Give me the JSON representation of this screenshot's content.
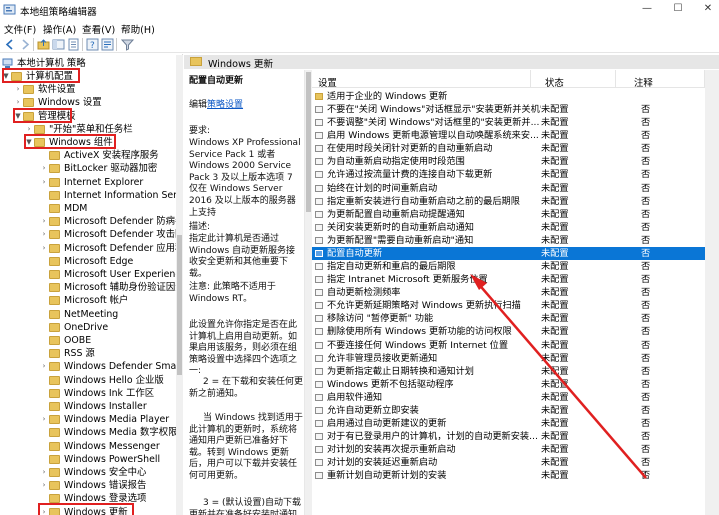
{
  "window": {
    "title": "本地组策略编辑器"
  },
  "menu": [
    "文件(F)",
    "操作(A)",
    "查看(V)",
    "帮助(H)"
  ],
  "tree": {
    "root": "本地计算机 策略",
    "items": [
      {
        "label": "计算机配置",
        "level": 1,
        "arrow": "▼",
        "highlight": true
      },
      {
        "label": "软件设置",
        "level": 2,
        "arrow": "›"
      },
      {
        "label": "Windows 设置",
        "level": 2,
        "arrow": "›"
      },
      {
        "label": "管理模板",
        "level": 2,
        "arrow": "▼",
        "highlight": true
      },
      {
        "label": "\"开始\"菜单和任务栏",
        "level": 3,
        "arrow": "›"
      },
      {
        "label": "Windows 组件",
        "level": 3,
        "arrow": "▼",
        "highlight": true
      },
      {
        "label": "ActiveX 安装程序服务",
        "level": 4,
        "arrow": ""
      },
      {
        "label": "BitLocker 驱动器加密",
        "level": 4,
        "arrow": "›"
      },
      {
        "label": "Internet Explorer",
        "level": 4,
        "arrow": "›"
      },
      {
        "label": "Internet Information Servic",
        "level": 4,
        "arrow": ""
      },
      {
        "label": "MDM",
        "level": 4,
        "arrow": ""
      },
      {
        "label": "Microsoft Defender 防病毒",
        "level": 4,
        "arrow": "›"
      },
      {
        "label": "Microsoft Defender 攻击防",
        "level": 4,
        "arrow": "›"
      },
      {
        "label": "Microsoft Defender 应用程",
        "level": 4,
        "arrow": "›"
      },
      {
        "label": "Microsoft Edge",
        "level": 4,
        "arrow": ""
      },
      {
        "label": "Microsoft User Experience",
        "level": 4,
        "arrow": ""
      },
      {
        "label": "Microsoft 辅助身份验证因素",
        "level": 4,
        "arrow": ""
      },
      {
        "label": "Microsoft 帐户",
        "level": 4,
        "arrow": ""
      },
      {
        "label": "NetMeeting",
        "level": 4,
        "arrow": ""
      },
      {
        "label": "OneDrive",
        "level": 4,
        "arrow": ""
      },
      {
        "label": "OOBE",
        "level": 4,
        "arrow": ""
      },
      {
        "label": "RSS 源",
        "level": 4,
        "arrow": ""
      },
      {
        "label": "Windows Defender SmartS",
        "level": 4,
        "arrow": "›"
      },
      {
        "label": "Windows Hello 企业版",
        "level": 4,
        "arrow": ""
      },
      {
        "label": "Windows Ink 工作区",
        "level": 4,
        "arrow": ""
      },
      {
        "label": "Windows Installer",
        "level": 4,
        "arrow": ""
      },
      {
        "label": "Windows Media Player",
        "level": 4,
        "arrow": "›"
      },
      {
        "label": "Windows Media 数字权限管",
        "level": 4,
        "arrow": ""
      },
      {
        "label": "Windows Messenger",
        "level": 4,
        "arrow": ""
      },
      {
        "label": "Windows PowerShell",
        "level": 4,
        "arrow": ""
      },
      {
        "label": "Windows 安全中心",
        "level": 4,
        "arrow": "›"
      },
      {
        "label": "Windows 错误报告",
        "level": 4,
        "arrow": "›"
      },
      {
        "label": "Windows 登录选项",
        "level": 4,
        "arrow": ""
      },
      {
        "label": "Windows 更新",
        "level": 4,
        "arrow": "›",
        "highlight": true
      }
    ]
  },
  "header": {
    "folder": "Windows 更新"
  },
  "description": {
    "title": "配置自动更新",
    "edit_prefix": "编辑",
    "edit_link": "策略设置",
    "requirement_label": "要求:",
    "requirement": "Windows XP Professional Service Pack 1 或者 Windows 2000 Service Pack 3 及以上版本选项 7 仅在 Windows Server 2016 及以上版本的服务器上支持",
    "desc_label": "描述:",
    "desc": "指定此计算机是否通过 Windows 自动更新服务接收安全更新和其他重要下载。",
    "note": "注意: 此策略不适用于 Windows RT。",
    "p1": "此设置允许你指定是否在此计算机上启用自动更新。如果启用该服务，则必须在组策略设置中选择四个选项之一:",
    "p2": "2 = 在下载和安装任何更新之前通知。",
    "p3": "当 Windows 找到适用于此计算机的更新时，系统将通知用户更新已准备好下载。转到 Windows 更新后，用户可以下载并安装任何可用更新。",
    "p4": "3 = (默认设置)自动下载更新并在准备好安装时通知"
  },
  "list": {
    "columns": {
      "setting": "设置",
      "state": "状态",
      "note": "注释"
    },
    "rows": [
      {
        "name": "适用于企业的 Windows 更新",
        "folder": true,
        "state": "",
        "note": ""
      },
      {
        "name": "不要在\"关闭 Windows\"对话框显示\"安装更新并关机\"",
        "state": "未配置",
        "note": "否"
      },
      {
        "name": "不要调整\"关闭 Windows\"对话框里的\"安装更新并...",
        "state": "未配置",
        "note": "否"
      },
      {
        "name": "启用 Windows 更新电源管理以自动唤醒系统来安...",
        "state": "未配置",
        "note": "否"
      },
      {
        "name": "在使用时段关闭针对更新的自动重新启动",
        "state": "未配置",
        "note": "否"
      },
      {
        "name": "为自动重新启动指定使用时段范围",
        "state": "未配置",
        "note": "否"
      },
      {
        "name": "允许通过按流量计费的连接自动下载更新",
        "state": "未配置",
        "note": "否"
      },
      {
        "name": "始终在计划的时间重新启动",
        "state": "未配置",
        "note": "否"
      },
      {
        "name": "指定重新安装进行自动重新启动之前的最后期限",
        "state": "未配置",
        "note": "否"
      },
      {
        "name": "为更新配置自动重新启动提醒通知",
        "state": "未配置",
        "note": "否"
      },
      {
        "name": "关闭安装更新时的自动重新启动通知",
        "state": "未配置",
        "note": "否"
      },
      {
        "name": "为更新配置\"需要自动重新启动\"通知",
        "state": "未配置",
        "note": "否"
      },
      {
        "name": "配置自动更新",
        "state": "未配置",
        "note": "否",
        "selected": true
      },
      {
        "name": "指定自动更新和重启的最后期限",
        "state": "未配置",
        "note": "否"
      },
      {
        "name": "指定 Intranet Microsoft 更新服务位置",
        "state": "未配置",
        "note": "否"
      },
      {
        "name": "自动更新检测频率",
        "state": "未配置",
        "note": "否"
      },
      {
        "name": "不允许更新延期策略对 Windows 更新执行扫描",
        "state": "未配置",
        "note": "否"
      },
      {
        "name": "移除访问 \"暂停更新\" 功能",
        "state": "未配置",
        "note": "否"
      },
      {
        "name": "删除使用所有 Windows 更新功能的访问权限",
        "state": "未配置",
        "note": "否"
      },
      {
        "name": "不要连接任何 Windows 更新 Internet 位置",
        "state": "未配置",
        "note": "否"
      },
      {
        "name": "允许非管理员接收更新通知",
        "state": "未配置",
        "note": "否"
      },
      {
        "name": "为更新指定截止日期转换和通知计划",
        "state": "未配置",
        "note": "否"
      },
      {
        "name": "Windows 更新不包括驱动程序",
        "state": "未配置",
        "note": "否"
      },
      {
        "name": "启用软件通知",
        "state": "未配置",
        "note": "否"
      },
      {
        "name": "允许自动更新立即安装",
        "state": "未配置",
        "note": "否"
      },
      {
        "name": "启用通过自动更新建议的更新",
        "state": "未配置",
        "note": "否"
      },
      {
        "name": "对于有已登录用户的计算机，计划的自动更新安装...",
        "state": "未配置",
        "note": "否"
      },
      {
        "name": "对计划的安装再次提示重新启动",
        "state": "未配置",
        "note": "否"
      },
      {
        "name": "对计划的安装延迟重新启动",
        "state": "未配置",
        "note": "否"
      },
      {
        "name": "重新计划自动更新计划的安装",
        "state": "未配置",
        "note": "否"
      }
    ]
  },
  "colors": {
    "selection": "#0a76d6",
    "highlight_box": "#e02020",
    "arrow": "#e02020",
    "link": "#0b57c5"
  }
}
